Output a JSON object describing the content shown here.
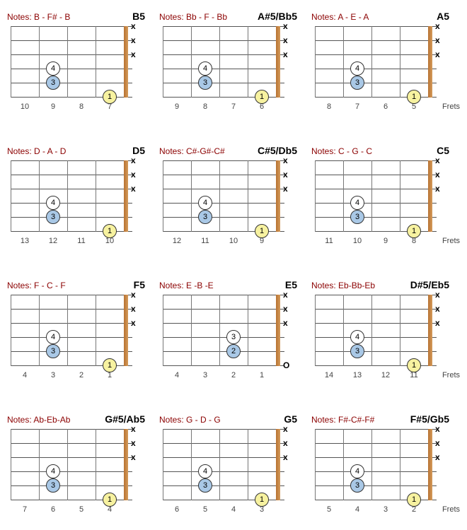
{
  "fretsLabel": "Frets",
  "muteSymbol": "x",
  "openSymbol": "O",
  "chords": [
    {
      "notes": "Notes: B - F# - B",
      "name": "B5",
      "fretNumbers": [
        "10",
        "9",
        "8",
        "7"
      ],
      "mutes": [
        0,
        1,
        2
      ],
      "open": [],
      "fingers": [
        {
          "fret": 1.5,
          "string": 3,
          "label": "4",
          "style": "white"
        },
        {
          "fret": 1.5,
          "string": 4,
          "label": "3",
          "style": "blue"
        },
        {
          "fret": 3.5,
          "string": 5,
          "label": "1",
          "style": "yellow"
        }
      ]
    },
    {
      "notes": "Notes: Bb - F - Bb",
      "name": "A#5/Bb5",
      "fretNumbers": [
        "9",
        "8",
        "7",
        "6"
      ],
      "mutes": [
        0,
        1,
        2
      ],
      "open": [],
      "fingers": [
        {
          "fret": 1.5,
          "string": 3,
          "label": "4",
          "style": "white"
        },
        {
          "fret": 1.5,
          "string": 4,
          "label": "3",
          "style": "blue"
        },
        {
          "fret": 3.5,
          "string": 5,
          "label": "1",
          "style": "yellow"
        }
      ]
    },
    {
      "notes": "Notes: A - E - A",
      "name": "A5",
      "fretNumbers": [
        "8",
        "7",
        "6",
        "5"
      ],
      "mutes": [
        0,
        1,
        2
      ],
      "open": [],
      "showFretsLabel": true,
      "fingers": [
        {
          "fret": 1.5,
          "string": 3,
          "label": "4",
          "style": "white"
        },
        {
          "fret": 1.5,
          "string": 4,
          "label": "3",
          "style": "blue"
        },
        {
          "fret": 3.5,
          "string": 5,
          "label": "1",
          "style": "yellow"
        }
      ]
    },
    {
      "notes": "Notes: D - A - D",
      "name": "D5",
      "fretNumbers": [
        "13",
        "12",
        "11",
        "10"
      ],
      "mutes": [
        0,
        1,
        2
      ],
      "open": [],
      "fingers": [
        {
          "fret": 1.5,
          "string": 3,
          "label": "4",
          "style": "white"
        },
        {
          "fret": 1.5,
          "string": 4,
          "label": "3",
          "style": "blue"
        },
        {
          "fret": 3.5,
          "string": 5,
          "label": "1",
          "style": "yellow"
        }
      ]
    },
    {
      "notes": "Notes: C#-G#-C#",
      "name": "C#5/Db5",
      "fretNumbers": [
        "12",
        "11",
        "10",
        "9"
      ],
      "mutes": [
        0,
        1,
        2
      ],
      "open": [],
      "fingers": [
        {
          "fret": 1.5,
          "string": 3,
          "label": "4",
          "style": "white"
        },
        {
          "fret": 1.5,
          "string": 4,
          "label": "3",
          "style": "blue"
        },
        {
          "fret": 3.5,
          "string": 5,
          "label": "1",
          "style": "yellow"
        }
      ]
    },
    {
      "notes": "Notes: C - G - C",
      "name": "C5",
      "fretNumbers": [
        "11",
        "10",
        "9",
        "8"
      ],
      "mutes": [
        0,
        1,
        2
      ],
      "open": [],
      "showFretsLabel": true,
      "fingers": [
        {
          "fret": 1.5,
          "string": 3,
          "label": "4",
          "style": "white"
        },
        {
          "fret": 1.5,
          "string": 4,
          "label": "3",
          "style": "blue"
        },
        {
          "fret": 3.5,
          "string": 5,
          "label": "1",
          "style": "yellow"
        }
      ]
    },
    {
      "notes": "Notes: F - C - F",
      "name": "F5",
      "fretNumbers": [
        "4",
        "3",
        "2",
        "1"
      ],
      "mutes": [
        0,
        1,
        2
      ],
      "open": [],
      "fingers": [
        {
          "fret": 1.5,
          "string": 3,
          "label": "4",
          "style": "white"
        },
        {
          "fret": 1.5,
          "string": 4,
          "label": "3",
          "style": "blue"
        },
        {
          "fret": 3.5,
          "string": 5,
          "label": "1",
          "style": "yellow"
        }
      ]
    },
    {
      "notes": "Notes: E -B -E",
      "name": "E5",
      "fretNumbers": [
        "4",
        "3",
        "2",
        "1"
      ],
      "mutes": [
        0,
        1,
        2
      ],
      "open": [
        5
      ],
      "fingers": [
        {
          "fret": 2.5,
          "string": 3,
          "label": "3",
          "style": "white"
        },
        {
          "fret": 2.5,
          "string": 4,
          "label": "2",
          "style": "blue"
        }
      ]
    },
    {
      "notes": "Notes: Eb-Bb-Eb",
      "name": "D#5/Eb5",
      "fretNumbers": [
        "14",
        "13",
        "12",
        "11"
      ],
      "mutes": [
        0,
        1,
        2
      ],
      "open": [],
      "showFretsLabel": true,
      "fingers": [
        {
          "fret": 1.5,
          "string": 3,
          "label": "4",
          "style": "white"
        },
        {
          "fret": 1.5,
          "string": 4,
          "label": "3",
          "style": "blue"
        },
        {
          "fret": 3.5,
          "string": 5,
          "label": "1",
          "style": "yellow"
        }
      ]
    },
    {
      "notes": "Notes: Ab-Eb-Ab",
      "name": "G#5/Ab5",
      "fretNumbers": [
        "7",
        "6",
        "5",
        "4"
      ],
      "mutes": [
        0,
        1,
        2
      ],
      "open": [],
      "fingers": [
        {
          "fret": 1.5,
          "string": 3,
          "label": "4",
          "style": "white"
        },
        {
          "fret": 1.5,
          "string": 4,
          "label": "3",
          "style": "blue"
        },
        {
          "fret": 3.5,
          "string": 5,
          "label": "1",
          "style": "yellow"
        }
      ]
    },
    {
      "notes": "Notes: G - D - G",
      "name": "G5",
      "fretNumbers": [
        "6",
        "5",
        "4",
        "3"
      ],
      "mutes": [
        0,
        1,
        2
      ],
      "open": [],
      "fingers": [
        {
          "fret": 1.5,
          "string": 3,
          "label": "4",
          "style": "white"
        },
        {
          "fret": 1.5,
          "string": 4,
          "label": "3",
          "style": "blue"
        },
        {
          "fret": 3.5,
          "string": 5,
          "label": "1",
          "style": "yellow"
        }
      ]
    },
    {
      "notes": "Notes: F#-C#-F#",
      "name": "F#5/Gb5",
      "fretNumbers": [
        "5",
        "4",
        "3",
        "2"
      ],
      "mutes": [
        0,
        1,
        2
      ],
      "open": [],
      "showFretsLabel": true,
      "fingers": [
        {
          "fret": 1.5,
          "string": 3,
          "label": "4",
          "style": "white"
        },
        {
          "fret": 1.5,
          "string": 4,
          "label": "3",
          "style": "blue"
        },
        {
          "fret": 3.5,
          "string": 5,
          "label": "1",
          "style": "yellow"
        }
      ]
    }
  ]
}
